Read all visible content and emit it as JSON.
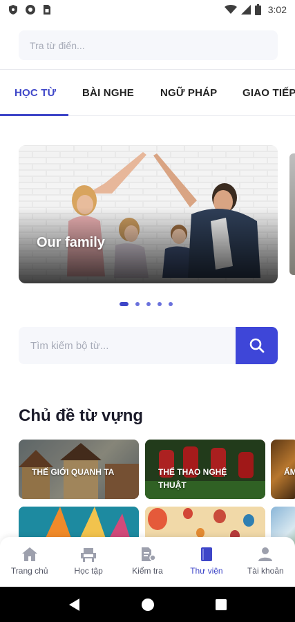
{
  "status_bar": {
    "time": "3:02",
    "left_icons": [
      "shield-icon",
      "circle-icon",
      "sim-card-icon"
    ],
    "right_icons": [
      "wifi-icon",
      "signal-icon",
      "battery-icon"
    ]
  },
  "dictionary_search": {
    "placeholder": "Tra từ điển..."
  },
  "tabs": [
    {
      "label": "HỌC TỪ",
      "active": true
    },
    {
      "label": "BÀI NGHE",
      "active": false
    },
    {
      "label": "NGỮ PHÁP",
      "active": false
    },
    {
      "label": "GIAO TIẾP",
      "active": false
    }
  ],
  "carousel": {
    "slides": [
      {
        "title": "Our family"
      }
    ],
    "page_count": 5,
    "active_index": 0
  },
  "wordset_search": {
    "placeholder": "Tìm kiếm bộ từ..."
  },
  "vocab_topics": {
    "title": "Chủ đề từ vựng",
    "cards": [
      {
        "label": "THẾ GIỚI QUANH TA"
      },
      {
        "label": "THỂ THAO NGHỆ THUẬT"
      },
      {
        "label": "ẨM"
      },
      {
        "label": ""
      },
      {
        "label": ""
      },
      {
        "label": ""
      }
    ]
  },
  "bottom_nav": [
    {
      "label": "Trang chủ",
      "icon": "home-icon",
      "active": false
    },
    {
      "label": "Học tập",
      "icon": "study-chair-icon",
      "active": false
    },
    {
      "label": "Kiểm tra",
      "icon": "test-document-icon",
      "active": false
    },
    {
      "label": "Thư viện",
      "icon": "library-book-icon",
      "active": true
    },
    {
      "label": "Tài khoản",
      "icon": "account-person-icon",
      "active": false
    }
  ],
  "colors": {
    "accent": "#3e46c8",
    "search_button": "#3e46d8",
    "input_background": "#f6f7fb",
    "inactive_icon": "#9da0ad"
  }
}
